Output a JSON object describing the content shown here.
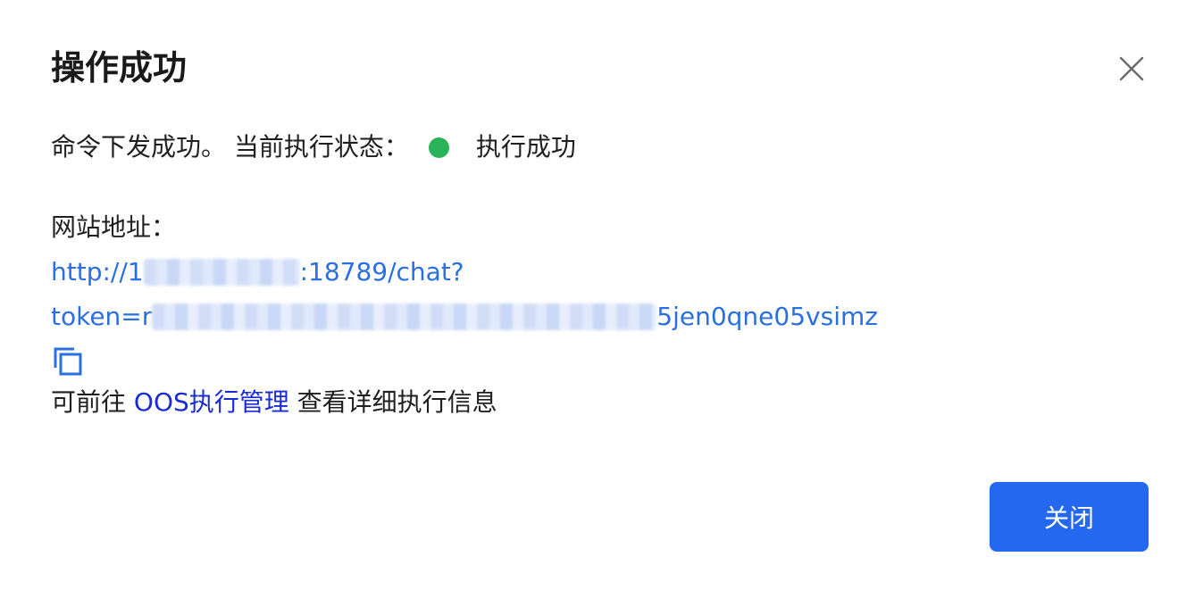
{
  "dialog": {
    "title": "操作成功",
    "close_icon": "close-icon"
  },
  "status": {
    "prefix": "命令下发成功。 当前执行状态：",
    "state_text": "执行成功",
    "state_color": "#2bb35a"
  },
  "site": {
    "label": "网站地址：",
    "url_line1_start": "http://1",
    "url_line1_end": ":18789/chat?",
    "url_line2_start": "token=r",
    "url_line2_end": "5jen0qne05vsimz",
    "copy_icon": "copy-icon"
  },
  "footer": {
    "prefix": "可前往 ",
    "link_text": "OOS执行管理",
    "suffix": " 查看详细执行信息"
  },
  "buttons": {
    "close_label": "关闭",
    "primary_color": "#2468f0"
  },
  "colors": {
    "link": "#2b6fe0",
    "oos_link": "#1a2bd6"
  }
}
